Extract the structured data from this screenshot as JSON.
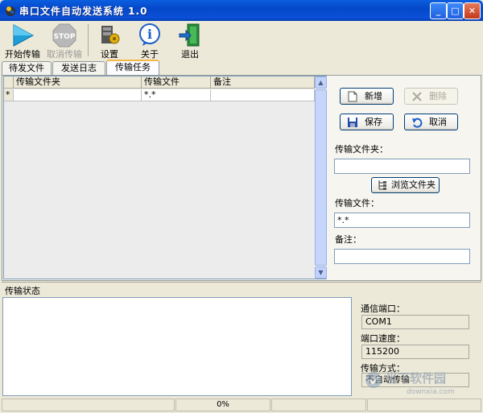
{
  "window": {
    "title": "串口文件自动发送系统 1.0",
    "minimize": "_",
    "maximize": "□",
    "close": "✕"
  },
  "toolbar": {
    "start": "开始传输",
    "cancel": "取消传输",
    "settings": "设置",
    "about": "关于",
    "exit": "退出"
  },
  "tabs": [
    "待发文件",
    "发送日志",
    "传输任务"
  ],
  "grid": {
    "columns": [
      "传输文件夹",
      "传输文件",
      "备注"
    ],
    "rows": [
      {
        "marker": "*",
        "folder": "",
        "file": "*.*",
        "note": ""
      }
    ]
  },
  "actions": {
    "add": "新增",
    "delete": "删除",
    "save": "保存",
    "cancel": "取消"
  },
  "form": {
    "folder_label": "传输文件夹：",
    "folder_value": "",
    "browse": "浏览文件夹",
    "file_label": "传输文件：",
    "file_value": "*.*",
    "note_label": "备注：",
    "note_value": ""
  },
  "status": {
    "label": "传输状态",
    "port_label": "通信端口：",
    "port_value": "COM1",
    "speed_label": "端口速度：",
    "speed_value": "115200",
    "mode_label": "传输方式：",
    "mode_value": "不自动传输"
  },
  "statusbar": {
    "progress": "0%"
  },
  "watermark": {
    "text": "当下软件园",
    "url": "downxia.com"
  }
}
